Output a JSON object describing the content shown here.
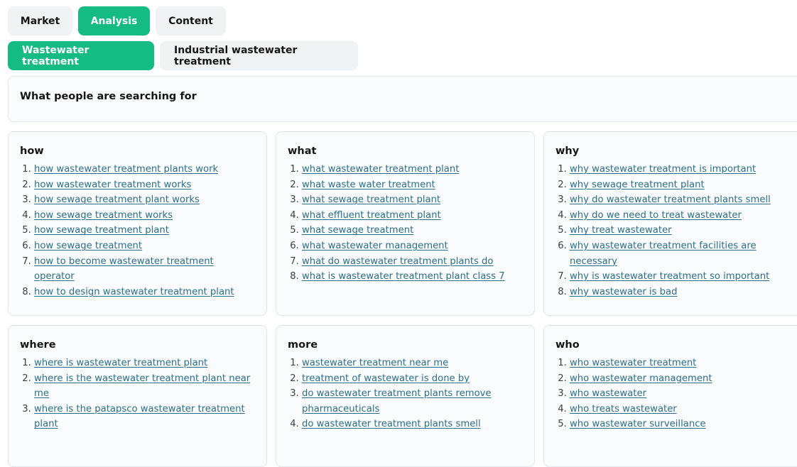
{
  "top_tabs": [
    {
      "label": "Market",
      "active": false
    },
    {
      "label": "Analysis",
      "active": true
    },
    {
      "label": "Content",
      "active": false
    }
  ],
  "sub_tabs": [
    {
      "label": "Wastewater treatment",
      "active": true
    },
    {
      "label": "Industrial wastewater treatment",
      "active": false
    }
  ],
  "section_title": "What people are searching for",
  "cards": [
    {
      "title": "how",
      "items": [
        "how wastewater treatment plants work",
        "how wastewater treatment works",
        "how sewage treatment plant works",
        "how sewage treatment works",
        "how sewage treatment plant",
        "how sewage treatment",
        "how to become wastewater treatment operator",
        "how to design wastewater treatment plant"
      ]
    },
    {
      "title": "what",
      "items": [
        "what wastewater treatment plant",
        "what waste water treatment",
        "what sewage treatment plant",
        "what effluent treatment plant",
        "what sewage treatment",
        "what wastewater management",
        "what do wastewater treatment plants do",
        "what is wastewater treatment plant class 7"
      ]
    },
    {
      "title": "why",
      "items": [
        "why wastewater treatment is important",
        "why sewage treatment plant",
        "why do wastewater treatment plants smell",
        "why do we need to treat wastewater",
        "why treat wastewater",
        "why wastewater treatment facilities are necessary",
        "why is wastewater treatment so important",
        "why wastewater is bad"
      ]
    },
    {
      "title": "where",
      "items": [
        "where is wastewater treatment plant",
        "where is the wastewater treatment plant near me",
        "where is the patapsco wastewater treatment plant"
      ]
    },
    {
      "title": "more",
      "items": [
        "wastewater treatment near me",
        "treatment of wastewater is done by",
        "do wastewater treatment plants remove pharmaceuticals",
        "do wastewater treatment plants smell"
      ]
    },
    {
      "title": "who",
      "items": [
        "who wastewater treatment",
        "who wastewater management",
        "who wastewater",
        "who treats wastewater",
        "who wastewater surveillance"
      ]
    }
  ],
  "colors": {
    "accent": "#14bb82",
    "link": "#2b6f8a",
    "tab_bg": "#f1f2f3",
    "card_bg": "#fafbfc",
    "border": "#e3e5e8"
  }
}
